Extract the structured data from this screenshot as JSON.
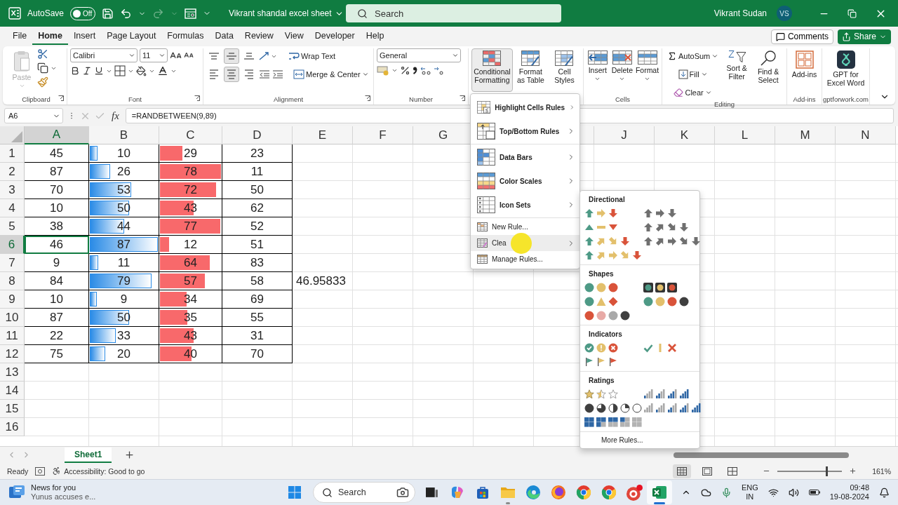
{
  "title_bar": {
    "autosave_label": "AutoSave",
    "autosave_on": false,
    "autosave_text": "Off",
    "redo_disabled": true,
    "document_title": "Vikrant shandal excel sheet",
    "search_placeholder": "Search",
    "user_name": "Vikrant Sudan",
    "user_initials": "VS"
  },
  "menu_tabs": [
    {
      "label": "File",
      "selected": false
    },
    {
      "label": "Home",
      "selected": true
    },
    {
      "label": "Insert",
      "selected": false
    },
    {
      "label": "Page Layout",
      "selected": false
    },
    {
      "label": "Formulas",
      "selected": false
    },
    {
      "label": "Data",
      "selected": false
    },
    {
      "label": "Review",
      "selected": false
    },
    {
      "label": "View",
      "selected": false
    },
    {
      "label": "Developer",
      "selected": false
    },
    {
      "label": "Help",
      "selected": false
    }
  ],
  "comments_button": "Comments",
  "share_button": "Share",
  "ribbon": {
    "clipboard": {
      "paste_label": "Paste",
      "paste_disabled": true,
      "group_label": "Clipboard"
    },
    "font": {
      "font_name": "Calibri",
      "font_size": "11",
      "group_label": "Font"
    },
    "alignment": {
      "vertical": [
        {
          "kind": "top",
          "selected": false
        },
        {
          "kind": "middle",
          "selected": true
        },
        {
          "kind": "bottom",
          "selected": false
        }
      ],
      "horizontal": [
        {
          "kind": "left",
          "selected": false
        },
        {
          "kind": "center",
          "selected": true
        },
        {
          "kind": "right",
          "selected": false
        }
      ],
      "wrap_text": "Wrap Text",
      "merge_center": "Merge & Center",
      "group_label": "Alignment"
    },
    "number": {
      "format": "General",
      "group_label": "Number"
    },
    "styles": [
      {
        "kind": "conditional",
        "label": "Conditional Formatting",
        "selected": true
      },
      {
        "kind": "table",
        "label": "Format as Table",
        "selected": false
      },
      {
        "kind": "cellstyles",
        "label": "Cell Styles",
        "selected": false
      }
    ],
    "cells": {
      "buttons": [
        {
          "kind": "insert",
          "label": "Insert"
        },
        {
          "kind": "delete",
          "label": "Delete"
        },
        {
          "kind": "format",
          "label": "Format"
        }
      ],
      "group_label": "Cells"
    },
    "editing": {
      "autosum": "AutoSum",
      "fill": "Fill",
      "clear": "Clear",
      "sort_filter": "Sort & Filter",
      "find_select": "Find & Select",
      "group_label": "Editing"
    },
    "addins": {
      "label": "Add-ins",
      "group_label": "Add-ins"
    },
    "gpt": {
      "label": "GPT for Excel Word",
      "group_label": "gptforwork.com"
    }
  },
  "formula_bar": {
    "name_box": "A6",
    "function_label": "fx",
    "formula": "=RANDBETWEEN(9,89)"
  },
  "sheet": {
    "columns": [
      {
        "label": "A",
        "selected": true
      },
      {
        "label": "B",
        "selected": false
      },
      {
        "label": "C",
        "selected": false
      },
      {
        "label": "D",
        "selected": false
      },
      {
        "label": "E",
        "selected": false
      },
      {
        "label": "F",
        "selected": false
      },
      {
        "label": "G",
        "selected": false
      },
      {},
      {
        "selected": false
      },
      {
        "label": "J",
        "selected": false
      },
      {
        "label": "K",
        "selected": false
      },
      {
        "label": "L",
        "selected": false
      },
      {
        "label": "M",
        "selected": false
      },
      {
        "label": "N",
        "selected": false
      }
    ],
    "rows": [
      {
        "num": "1",
        "selected": false,
        "a": "45",
        "b": "10",
        "b_bar": {
          "level": 0.115
        },
        "c": "29",
        "c_bar": {
          "level": 0.372
        },
        "d": "23"
      },
      {
        "num": "2",
        "selected": false,
        "a": "87",
        "b": "26",
        "b_bar": {
          "level": 0.299
        },
        "c": "78",
        "c_bar": {
          "level": 1
        },
        "d": "11"
      },
      {
        "num": "3",
        "selected": false,
        "a": "70",
        "b": "53",
        "b_bar": {
          "level": 0.609
        },
        "c": "72",
        "c_bar": {
          "level": 0.923
        },
        "d": "50"
      },
      {
        "num": "4",
        "selected": false,
        "a": "10",
        "b": "50",
        "b_bar": {
          "level": 0.575
        },
        "c": "43",
        "c_bar": {
          "level": 0.551
        },
        "d": "62"
      },
      {
        "num": "5",
        "selected": false,
        "a": "38",
        "b": "44",
        "b_bar": {
          "level": 0.506
        },
        "c": "77",
        "c_bar": {
          "level": 0.987
        },
        "d": "52"
      },
      {
        "num": "6",
        "selected": true,
        "a": "46",
        "b": "87",
        "b_bar": {
          "level": 1
        },
        "c": "12",
        "c_bar": {
          "level": 0.154
        },
        "d": "51"
      },
      {
        "num": "7",
        "selected": false,
        "a": "9",
        "b": "11",
        "b_bar": {
          "level": 0.126
        },
        "c": "64",
        "c_bar": {
          "level": 0.821
        },
        "d": "83"
      },
      {
        "num": "8",
        "selected": false,
        "a": "84",
        "b": "79",
        "b_bar": {
          "level": 0.908
        },
        "c": "57",
        "c_bar": {
          "level": 0.731
        },
        "d": "58",
        "e": "46.95833"
      },
      {
        "num": "9",
        "selected": false,
        "a": "10",
        "b": "9",
        "b_bar": {
          "level": 0.103
        },
        "c": "34",
        "c_bar": {
          "level": 0.436
        },
        "d": "69"
      },
      {
        "num": "10",
        "selected": false,
        "a": "87",
        "b": "50",
        "b_bar": {
          "level": 0.575
        },
        "c": "35",
        "c_bar": {
          "level": 0.449
        },
        "d": "55"
      },
      {
        "num": "11",
        "selected": false,
        "a": "22",
        "b": "33",
        "b_bar": {
          "level": 0.379
        },
        "c": "43",
        "c_bar": {
          "level": 0.551
        },
        "d": "31"
      },
      {
        "num": "12",
        "selected": false,
        "a": "75",
        "b": "20",
        "b_bar": {
          "level": 0.23
        },
        "c": "40",
        "c_bar": {
          "level": 0.513
        },
        "d": "70"
      }
    ],
    "empty_rows": [
      {
        "num": "13"
      },
      {
        "num": "14"
      },
      {
        "num": "15"
      },
      {
        "num": "16"
      }
    ]
  },
  "conditional_menu": [
    {
      "kind": "highlight",
      "label": "Highlight Cells Rules",
      "submenu": true,
      "divider_above": false,
      "selected": false
    },
    {
      "kind": "topbottom",
      "label": "Top/Bottom Rules",
      "submenu": true,
      "divider_above": false,
      "selected": false
    },
    {
      "kind": "databars",
      "label": "Data Bars",
      "submenu": true,
      "divider_above": true,
      "selected": false
    },
    {
      "kind": "colorscales",
      "label": "Color Scales",
      "submenu": true,
      "divider_above": false,
      "selected": false
    },
    {
      "kind": "iconsets",
      "label": "Icon Sets",
      "submenu": true,
      "divider_above": false,
      "selected": false
    },
    {
      "kind": "newrule",
      "label": "New Rule...",
      "submenu": false,
      "divider_above": true,
      "selected": false
    },
    {
      "kind": "clearrules",
      "label": "Clea",
      "submenu": true,
      "divider_above": false,
      "selected": true
    },
    {
      "kind": "managerules",
      "label": "Manage Rules...",
      "submenu": false,
      "divider_above": false,
      "selected": false
    }
  ],
  "icon_sets_menu": {
    "sections": [
      {
        "title": "Directional",
        "sets": [
          {
            "kind": "arrows3c"
          },
          {
            "kind": "arrows3g"
          },
          {
            "kind": "tri3"
          },
          {
            "kind": "arrows4g"
          },
          {
            "kind": "arrows4c"
          },
          {
            "kind": "arrows5g"
          },
          {
            "kind": "arrows5c"
          }
        ]
      },
      {
        "title": "Shapes",
        "sets": [
          {
            "kind": "traffic3"
          },
          {
            "kind": "traffic3r"
          },
          {
            "kind": "signs3"
          },
          {
            "kind": "traffic4"
          },
          {
            "kind": "redblack4"
          }
        ]
      },
      {
        "title": "Indicators",
        "sets": [
          {
            "kind": "symbols3c"
          },
          {
            "kind": "symbols3"
          },
          {
            "kind": "flags3"
          }
        ]
      },
      {
        "title": "Ratings",
        "sets": [
          {
            "kind": "stars3"
          },
          {
            "kind": "bars4"
          },
          {
            "kind": "quarters5"
          },
          {
            "kind": "bars5"
          },
          {
            "kind": "boxes5"
          }
        ]
      }
    ],
    "more_rules": "More Rules..."
  },
  "sheet_tabs": [
    {
      "label": "Sheet1",
      "selected": true
    }
  ],
  "status_bar": {
    "ready": "Ready",
    "accessibility": "Accessibility: Good to go",
    "views": [
      {
        "kind": "normal",
        "selected": true
      },
      {
        "kind": "pagelayout",
        "selected": false
      },
      {
        "kind": "pagebreak",
        "selected": false
      }
    ],
    "zoom": {
      "level": 0.76,
      "text": "161%"
    }
  },
  "taskbar": {
    "news_title": "News for you",
    "news_text": "Yunus accuses e...",
    "search_placeholder": "Search",
    "apps": [
      {
        "kind": "taskview",
        "running": false,
        "selected": false
      },
      {
        "kind": "copilot",
        "running": false,
        "selected": false
      },
      {
        "kind": "store",
        "running": false,
        "selected": false
      },
      {
        "kind": "folder",
        "running": true,
        "selected": false
      },
      {
        "kind": "edge",
        "running": false,
        "selected": false
      },
      {
        "kind": "firefox",
        "running": false,
        "selected": false
      },
      {
        "kind": "chrome",
        "running": false,
        "selected": false
      },
      {
        "kind": "chrome",
        "running": false,
        "selected": false
      },
      {
        "kind": "record",
        "running": false,
        "selected": false
      },
      {
        "kind": "excel",
        "running": true,
        "selected": true
      }
    ],
    "language": "ENG",
    "region": "IN",
    "time": "09:48",
    "date": "19-08-2024"
  }
}
